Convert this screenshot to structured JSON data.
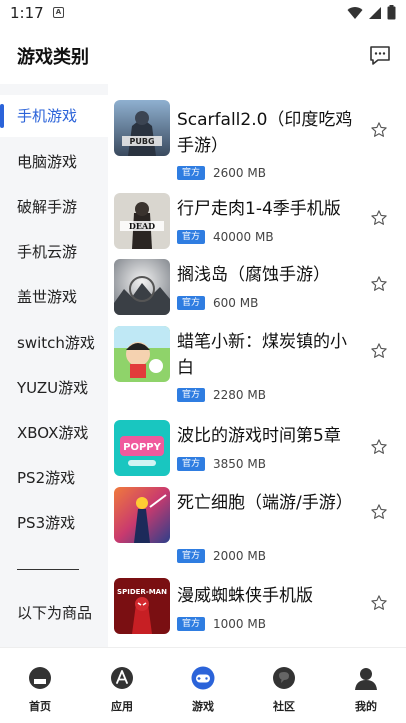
{
  "status": {
    "time": "1:17",
    "notif": "A"
  },
  "header": {
    "title": "游戏类别"
  },
  "sidebar": {
    "items": [
      {
        "label": "手机游戏"
      },
      {
        "label": "电脑游戏"
      },
      {
        "label": "破解手游"
      },
      {
        "label": "手机云游"
      },
      {
        "label": "盖世游戏"
      },
      {
        "label": "switch游戏"
      },
      {
        "label": "YUZU游戏"
      },
      {
        "label": "XBOX游戏"
      },
      {
        "label": "PS2游戏"
      },
      {
        "label": "PS3游戏"
      },
      {
        "label": "以下为商品"
      }
    ]
  },
  "games": [
    {
      "name": "Scarfall2.0（印度吃鸡手游）",
      "badge": "官方",
      "size": "2600 MB"
    },
    {
      "name": "行尸走肉1-4季手机版",
      "badge": "官方",
      "size": "40000 MB"
    },
    {
      "name": "搁浅岛（腐蚀手游）",
      "badge": "官方",
      "size": "600 MB"
    },
    {
      "name": "蜡笔小新：煤炭镇的小白",
      "badge": "官方",
      "size": "2280 MB"
    },
    {
      "name": "波比的游戏时间第5章",
      "badge": "官方",
      "size": "3850 MB"
    },
    {
      "name": "死亡细胞（端游/手游）",
      "badge": "官方",
      "size": "2000 MB"
    },
    {
      "name": "漫威蜘蛛侠手机版",
      "badge": "官方",
      "size": "1000 MB"
    }
  ],
  "thumb_text": {
    "pubg": "PUBG",
    "dead": "DEAD",
    "poppy": "POPPY",
    "spider": "SPIDER-MAN"
  },
  "nav": [
    {
      "label": "首页"
    },
    {
      "label": "应用"
    },
    {
      "label": "游戏"
    },
    {
      "label": "社区"
    },
    {
      "label": "我的"
    }
  ],
  "colors": {
    "accent": "#2b63d9",
    "badge": "#2f7de1",
    "active_nav": "#2b63d9"
  }
}
